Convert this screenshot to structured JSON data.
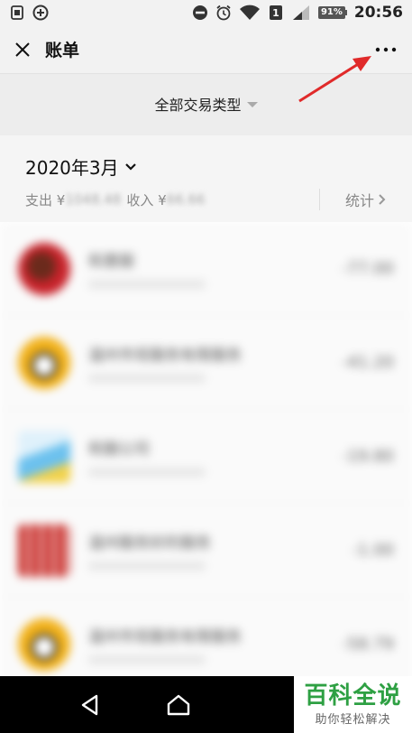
{
  "status_bar": {
    "battery": "91%",
    "time": "20:56",
    "sim_label": "1"
  },
  "header": {
    "title": "账单"
  },
  "filter": {
    "label": "全部交易类型"
  },
  "month": {
    "selected": "2020年3月",
    "expense_label": "支出 ¥",
    "expense_value": "1048.48",
    "income_label": "收入 ¥",
    "income_value": "66.66",
    "stats_label": "统计"
  },
  "transactions": [
    {
      "name": "和惠服",
      "amount": "-77.00"
    },
    {
      "name": "温州市现服务有限服务",
      "amount": "-41.20"
    },
    {
      "name": "和服公司",
      "amount": "-19.80"
    },
    {
      "name": "温州服务好的服务",
      "amount": "-1.00"
    },
    {
      "name": "温州市现服务有限服务",
      "amount": "-58.79"
    }
  ],
  "watermark": {
    "top": "百科全说",
    "bottom": "助你轻松解决"
  },
  "colors": {
    "accent_red": "#e02a2a",
    "watermark_green": "#2ea043"
  }
}
